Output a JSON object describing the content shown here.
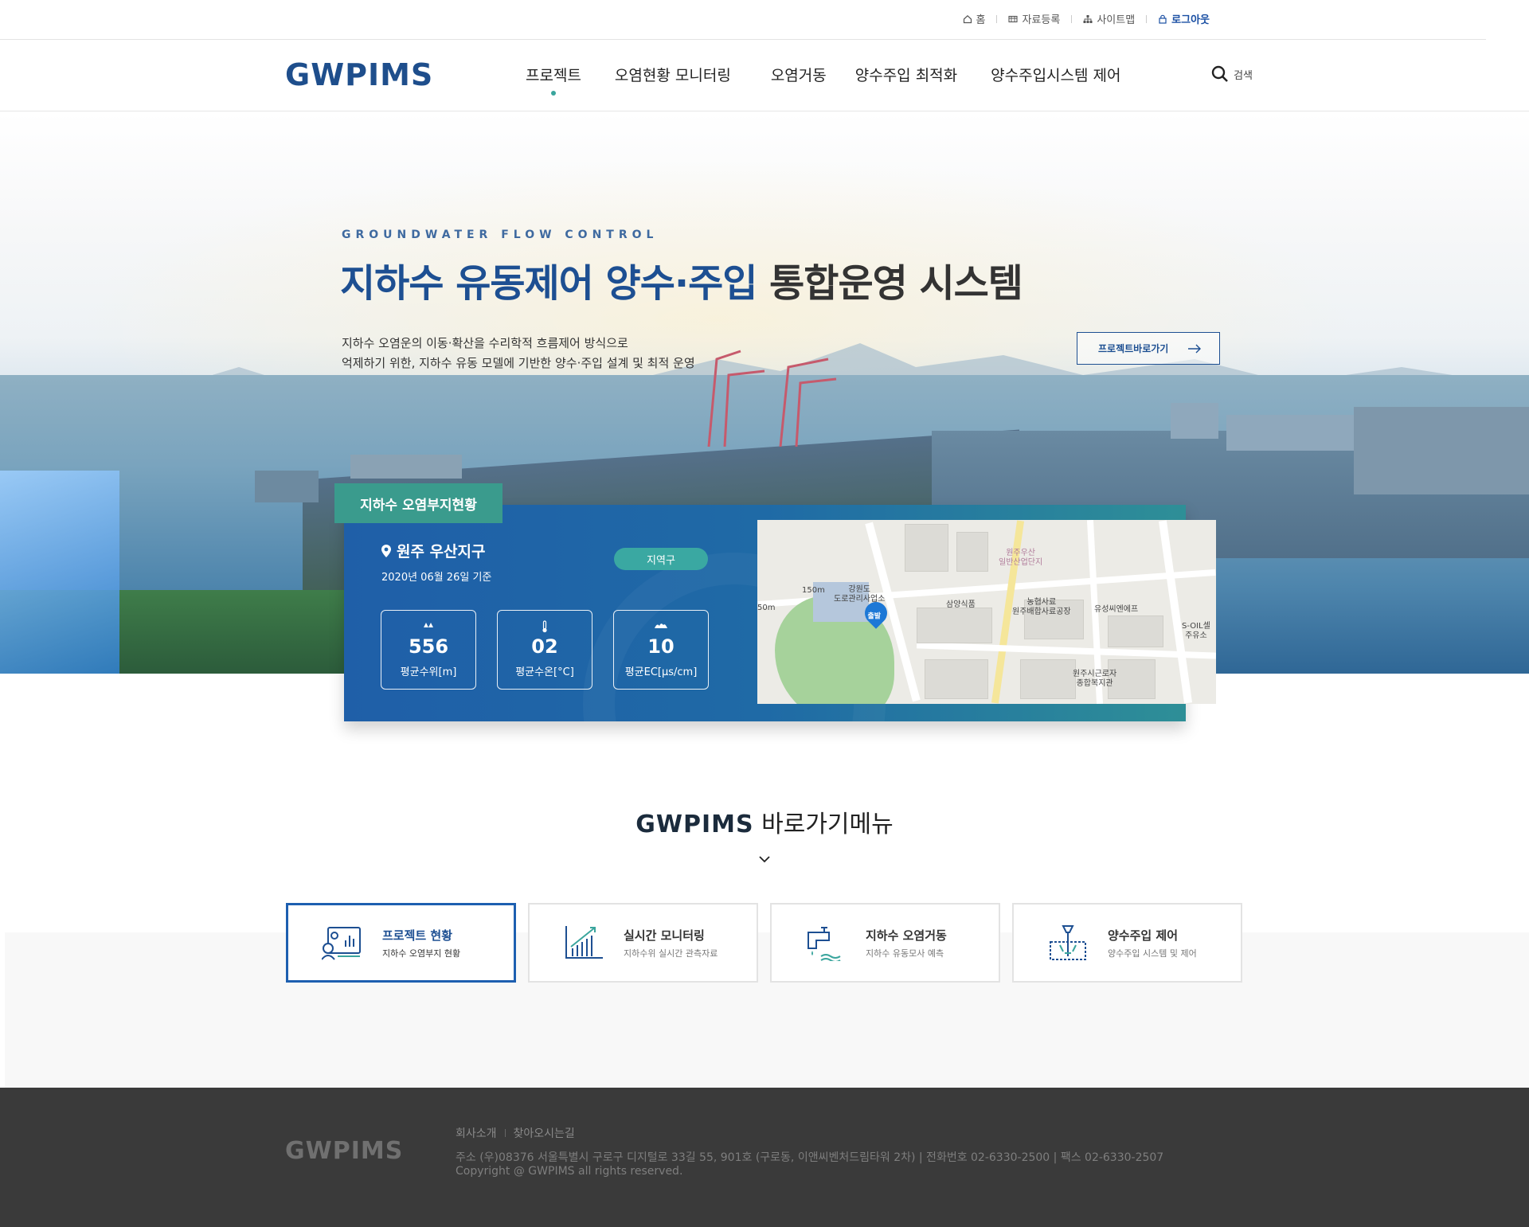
{
  "util": {
    "home": "홈",
    "data_register": "자료등록",
    "sitemap": "사이트맵",
    "logout": "로그아웃"
  },
  "header": {
    "logo": "GWPIMS",
    "nav": [
      "프로젝트",
      "오염현황 모니터링",
      "오염거동",
      "양수주입 최적화",
      "양수주입시스템 제어"
    ],
    "active_nav": "프로젝트",
    "search_label": "검색"
  },
  "hero": {
    "subtitle": "GROUNDWATER FLOW CONTROL",
    "title_blue": "지하수 유동제어 양수·주입",
    "title_dark": " 통합운영 시스템",
    "desc_line1": "지하수 오염운의 이동·확산을 수리학적 흐름제어 방식으로",
    "desc_line2": "억제하기 위한, 지하수 유동 모델에 기반한 양수·주입 설계 및  최적 운영",
    "button": "프로젝트바로가기"
  },
  "status": {
    "tab": "지하수 오염부지현황",
    "location": "원주 우산지구",
    "date": "2020년 06월 26일 기준",
    "region_btn": "지역구",
    "stats": [
      {
        "value": "556",
        "label": "평균수위[m]",
        "icon": "water-level-icon"
      },
      {
        "value": "02",
        "label": "평균수온[°C]",
        "icon": "thermometer-icon"
      },
      {
        "value": "10",
        "label": "평균EC[μs/cm]",
        "icon": "wave-icon"
      }
    ]
  },
  "map": {
    "labels": {
      "office": "강원도\n도로관리사업소",
      "complex": "원주우산\n일반산업단지",
      "samyang": "삼양식품",
      "nonghyup": "농협사료\n원주배합사료공장",
      "yusung": "유성씨엔에프",
      "soil": "S-OIL셀\n주유소",
      "welfare": "원주시근로자\n종합복지관",
      "scale150": "150m",
      "scale50": "50m",
      "pin": "출발"
    }
  },
  "quick": {
    "title_logo": "GWPIMS",
    "title_text": " 바로가기메뉴",
    "items": [
      {
        "title": "프로젝트 현황",
        "sub": "지하수 오염부지 현황",
        "icon": "project-status-icon"
      },
      {
        "title": "실시간 모니터링",
        "sub": "지하수위 실시간 관측자료",
        "icon": "chart-monitoring-icon"
      },
      {
        "title": "지하수 오염거동",
        "sub": "지하수 유동모사 예측",
        "icon": "faucet-icon"
      },
      {
        "title": "양수주입 제어",
        "sub": "양수주입 시스템 및 제어",
        "icon": "pump-control-icon"
      }
    ]
  },
  "footer": {
    "logo": "GWPIMS",
    "links": [
      "회사소개",
      "찾아오시는길"
    ],
    "address": "주소  (우)08376 서울특별시 구로구 디지털로 33길 55, 901호 (구로동, 이앤씨벤처드림타워 2차)   |   전화번호  02-6330-2500  |  팩스  02-6330-2507",
    "copyright": "Copyright @ GWPIMS all rights reserved."
  }
}
